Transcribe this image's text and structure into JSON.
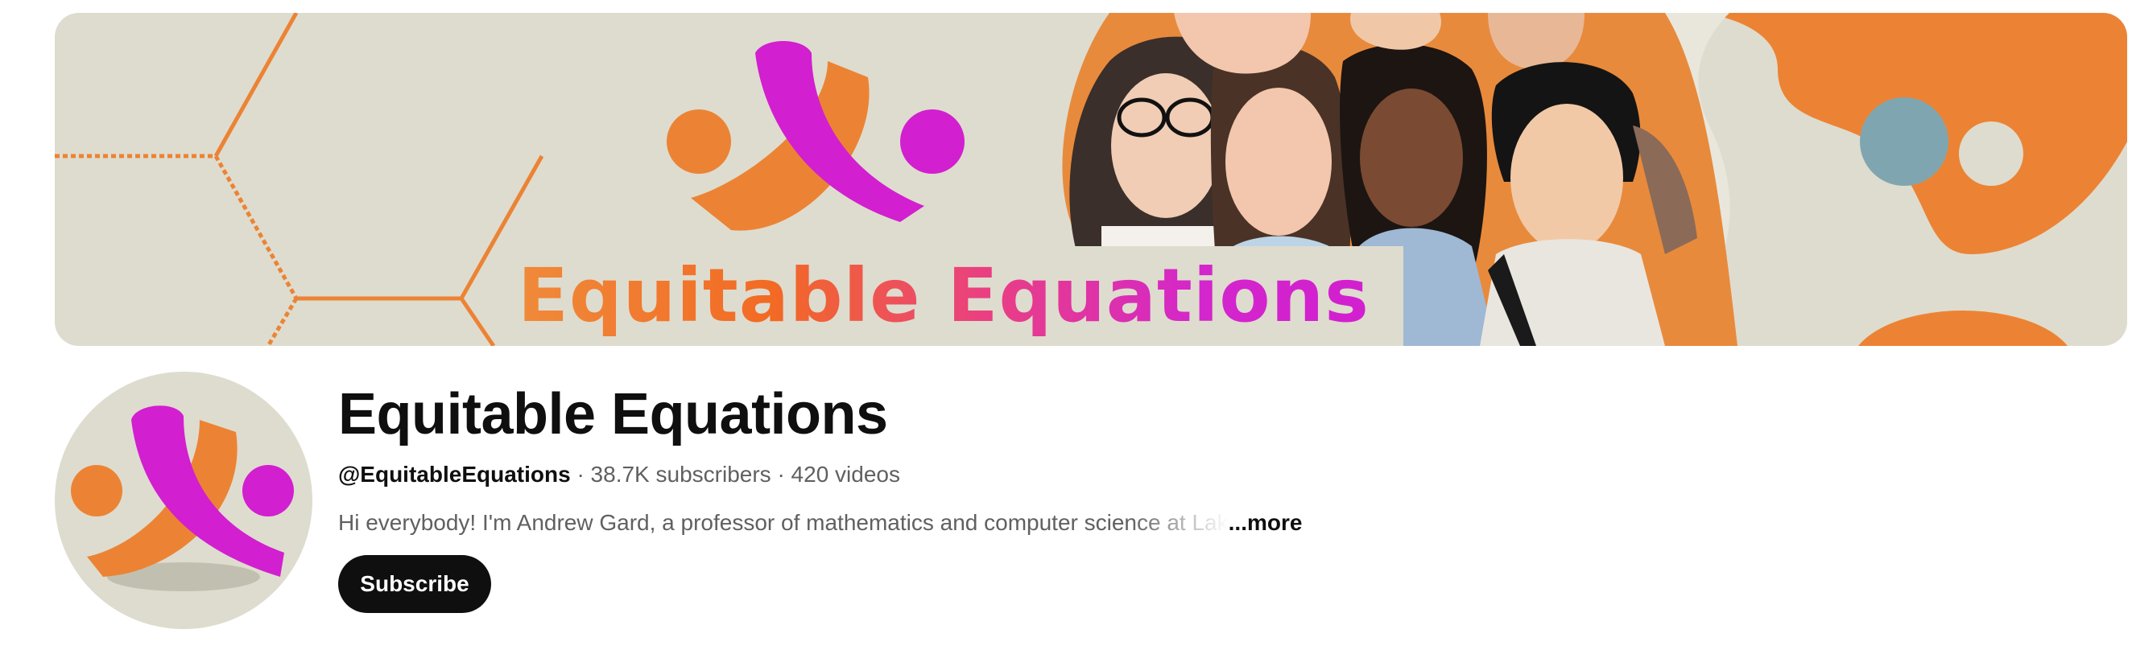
{
  "banner": {
    "title": "Equitable Equations",
    "colors": {
      "background": "#dedcce",
      "orange": "#ec8334",
      "magenta": "#d21fd0"
    }
  },
  "channel": {
    "name": "Equitable Equations",
    "handle": "@EquitableEquations",
    "separator": "·",
    "subscribers": "38.7K subscribers",
    "videos": "420 videos",
    "description": "Hi everybody! I'm Andrew Gard, a professor of mathematics and computer science at Lak",
    "more_label": "...more"
  },
  "actions": {
    "subscribe_label": "Subscribe"
  }
}
